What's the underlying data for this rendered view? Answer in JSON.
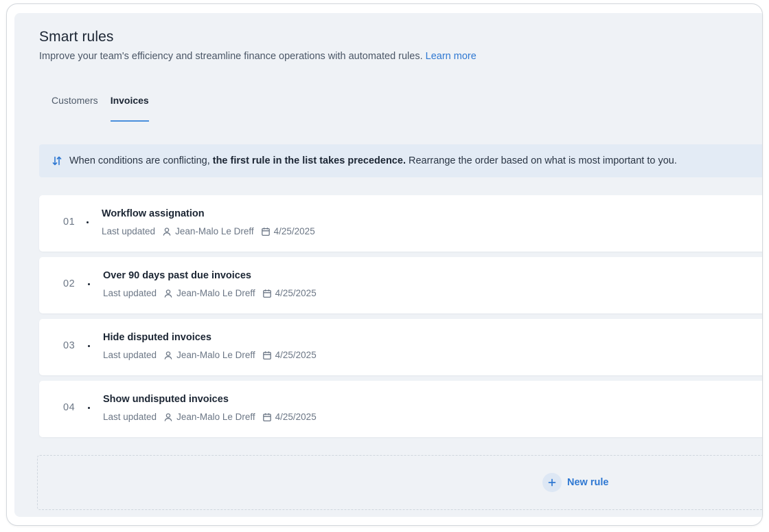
{
  "header": {
    "title": "Smart rules",
    "subtitle": "Improve your team's efficiency and streamline finance operations with automated rules.",
    "learn_more": "Learn more"
  },
  "tabs": [
    {
      "label": "Customers",
      "active": false
    },
    {
      "label": "Invoices",
      "active": true
    }
  ],
  "banner": {
    "icon": "sort-arrows-icon",
    "text_before": "When conditions are conflicting,",
    "text_bold": "the first rule in the list takes precedence.",
    "text_after": "Rearrange the order based on what is most important to you."
  },
  "rules": [
    {
      "number": "01",
      "title": "Workflow assignation",
      "meta_label": "Last updated",
      "author": "Jean-Malo Le Dreff",
      "date": "4/25/2025"
    },
    {
      "number": "02",
      "title": "Over 90 days past due invoices",
      "meta_label": "Last updated",
      "author": "Jean-Malo Le Dreff",
      "date": "4/25/2025"
    },
    {
      "number": "03",
      "title": "Hide disputed invoices",
      "meta_label": "Last updated",
      "author": "Jean-Malo Le Dreff",
      "date": "4/25/2025"
    },
    {
      "number": "04",
      "title": "Show undisputed invoices",
      "meta_label": "Last updated",
      "author": "Jean-Malo Le Dreff",
      "date": "4/25/2025"
    }
  ],
  "new_rule": {
    "label": "New rule",
    "icon": "plus-icon"
  },
  "colors": {
    "accent": "#2f78d2",
    "panel_bg": "#eff2f6",
    "banner_bg": "#e3ebf5"
  }
}
